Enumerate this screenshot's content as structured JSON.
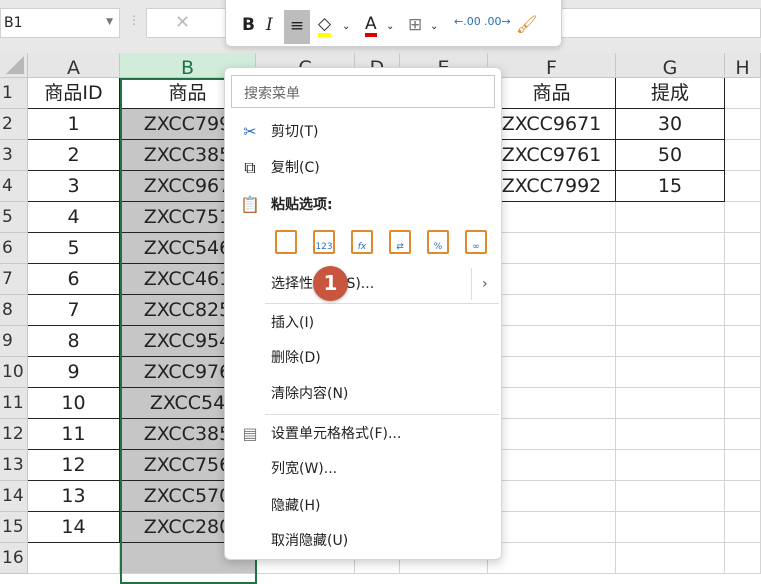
{
  "formula_bar": {
    "name_box": "B1"
  },
  "mini_toolbar": {
    "bold": "B",
    "italic": "I",
    "font_color_letter": "A",
    "fill_color": "#ffff00",
    "font_color": "#e00000"
  },
  "columns": [
    "A",
    "B",
    "C",
    "D",
    "E",
    "F",
    "G",
    "H"
  ],
  "rows": [
    "1",
    "2",
    "3",
    "4",
    "5",
    "6",
    "7",
    "8",
    "9",
    "10",
    "11",
    "12",
    "13",
    "14",
    "15",
    "16"
  ],
  "sheet": {
    "A": [
      "商品ID",
      "1",
      "2",
      "3",
      "4",
      "5",
      "6",
      "7",
      "8",
      "9",
      "10",
      "11",
      "12",
      "13",
      "14"
    ],
    "B": [
      "商品",
      "ZXCC799",
      "ZXCC385",
      "ZXCC967",
      "ZXCC751",
      "ZXCC546",
      "ZXCC461",
      "ZXCC825",
      "ZXCC954",
      "ZXCC976",
      "ZXCC54",
      "ZXCC385",
      "ZXCC756",
      "ZXCC570",
      "ZXCC280"
    ],
    "F": [
      "商品",
      "ZXCC9671",
      "ZXCC9761",
      "ZXCC7992"
    ],
    "G": [
      "提成",
      "30",
      "50",
      "15"
    ]
  },
  "context_menu": {
    "search_placeholder": "搜索菜单",
    "cut": "剪切(T)",
    "copy": "复制(C)",
    "paste_options": "粘贴选项:",
    "paste_icons": [
      "粘贴",
      "123",
      "fx",
      "⇄",
      "%",
      "∞"
    ],
    "paste_special": "选择性粘贴(S)...",
    "insert": "插入(I)",
    "delete": "删除(D)",
    "clear": "清除内容(N)",
    "format_cells": "设置单元格格式(F)...",
    "col_width": "列宽(W)...",
    "hide": "隐藏(H)",
    "unhide": "取消隐藏(U)"
  },
  "badge": "1"
}
